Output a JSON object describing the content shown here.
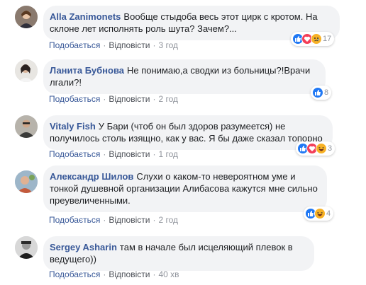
{
  "labels": {
    "like": "Подобається",
    "reply": "Відповісти"
  },
  "comments": [
    {
      "author": "Alla Zanimonets",
      "text": "Вообще стыдоба весь этот цирк с кротом. На склоне лет исполнять роль шута? Зачем?...",
      "time": "3 год",
      "reactions": [
        "like-icon",
        "love-icon",
        "sad-icon"
      ],
      "reaction_count": "17"
    },
    {
      "author": "Ланита Бубнова",
      "text": "Не понимаю,а сводки из больницы?!Врачи лгали?!",
      "time": "2 год",
      "reactions": [
        "like-icon"
      ],
      "reaction_count": "8"
    },
    {
      "author": "Vitaly Fish",
      "text": "У Бари (чтоб он был здоров разумеется) не получилось столь изящно, как у вас. Я бы даже сказал топорно",
      "time": "1 год",
      "reactions": [
        "like-icon",
        "love-icon",
        "haha-icon"
      ],
      "reaction_count": "3"
    },
    {
      "author": "Александр Шилов",
      "text": "Слухи о каком-то невероятном уме и тонкой душевной организации Алибасова кажутся мне сильно преувеличенными.",
      "time": "2 год",
      "reactions": [
        "like-icon",
        "haha-icon"
      ],
      "reaction_count": "4"
    },
    {
      "author": "Sergey Asharin",
      "text": "там в начале был исцеляющий плевок в ведущего))",
      "time": "40 хв",
      "reactions": [],
      "reaction_count": ""
    }
  ],
  "colors": {
    "author": "#385898",
    "bubble": "#f2f3f5",
    "meta": "#90949c",
    "like": "#2078f4",
    "love": "#f33e58",
    "sad_haha": "#f7b125"
  }
}
